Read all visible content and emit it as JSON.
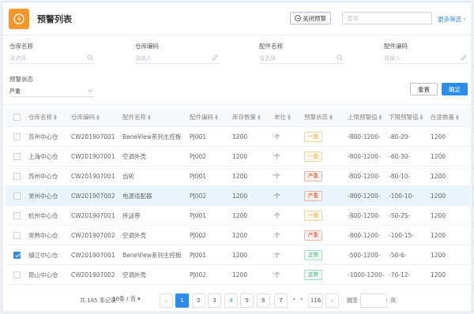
{
  "header": {
    "title": "预警列表",
    "close_warning_label": "关闭预警",
    "search_placeholder": "搜索",
    "more_filters_label": "更多筛选"
  },
  "filters": {
    "warehouse_name": {
      "label": "仓库名称",
      "placeholder": "请选择"
    },
    "warehouse_code": {
      "label": "仓库编码",
      "placeholder": "请输入"
    },
    "part_name": {
      "label": "配件名称",
      "placeholder": "请选择"
    },
    "part_code": {
      "label": "配件编码",
      "placeholder": "请输入"
    },
    "warning_status": {
      "label": "预警状态",
      "value": "严重"
    },
    "reset_label": "重置",
    "confirm_label": "确定"
  },
  "table": {
    "columns": [
      "仓库名称",
      "仓库编码",
      "配件名称",
      "配件编码",
      "库存数量",
      "单位",
      "预警状态",
      "上限预警值",
      "下限预警值",
      "在途数量"
    ],
    "rows": [
      {
        "wh": "苏州中心仓",
        "code": "CW201907001",
        "part": "BeneView系列主控板",
        "pcode": "PJ001",
        "qty": "1200",
        "unit": "个",
        "status": "一般",
        "upper": "-800-1200-",
        "lower": "-80-20-",
        "transit": "1200",
        "checked": false,
        "highlight": false
      },
      {
        "wh": "上海中心仓",
        "code": "CW201907001",
        "part": "空调外壳",
        "pcode": "PJ002",
        "qty": "1200",
        "unit": "个",
        "status": "一般",
        "upper": "-800-1200-",
        "lower": "-60-30-",
        "transit": "1200",
        "checked": false,
        "highlight": false
      },
      {
        "wh": "苏州中心仓",
        "code": "CW201907001",
        "part": "齿轮",
        "pcode": "PJ001",
        "qty": "1200",
        "unit": "个",
        "status": "严重",
        "upper": "-800-1200-",
        "lower": "-80-10-",
        "transit": "1200",
        "checked": false,
        "highlight": false
      },
      {
        "wh": "常州中心仓",
        "code": "CW201907002",
        "part": "电源适配器",
        "pcode": "PJ002",
        "qty": "1200",
        "unit": "个",
        "status": "严重",
        "upper": "-800-1200-",
        "lower": "-100-10-",
        "transit": "1200",
        "checked": false,
        "highlight": true
      },
      {
        "wh": "杭州中心仓",
        "code": "CW201907001",
        "part": "传送带",
        "pcode": "PJ001",
        "qty": "1200",
        "unit": "个",
        "status": "一般",
        "upper": "-800-1200-",
        "lower": "-50-25-",
        "transit": "1200",
        "checked": false,
        "highlight": false
      },
      {
        "wh": "常熟中心仓",
        "code": "CW201907002",
        "part": "空调外壳",
        "pcode": "PJ002",
        "qty": "1200",
        "unit": "个",
        "status": "严重",
        "upper": "-800-1200-",
        "lower": "-100-15-",
        "transit": "1200",
        "checked": false,
        "highlight": false
      },
      {
        "wh": "镇江中心仓",
        "code": "CW201907001",
        "part": "BeneView系列主控板",
        "pcode": "PJ001",
        "qty": "1200",
        "unit": "个",
        "status": "正常",
        "upper": "-500-1200-",
        "lower": "-50-6-",
        "transit": "1200",
        "checked": true,
        "highlight": false
      },
      {
        "wh": "昆山中心仓",
        "code": "CW201907002",
        "part": "空调外壳",
        "pcode": "PJ002",
        "qty": "1200",
        "unit": "个",
        "status": "正常",
        "upper": "-1000-1200-",
        "lower": "-70-12-",
        "transit": "1200",
        "checked": false,
        "highlight": false
      }
    ]
  },
  "status_colors": {
    "一般": {
      "text": "#f5a623",
      "border": "#f8d49a",
      "bg": "#fff8ec"
    },
    "严重": {
      "text": "#ed4014",
      "border": "#f7b2a0",
      "bg": "#fff1ee"
    },
    "正常": {
      "text": "#19be6b",
      "border": "#9ee3bf",
      "bg": "#eefaf3"
    }
  },
  "pagination": {
    "total_prefix": "共",
    "total": "185",
    "total_suffix": "条记录",
    "page_size": "10条 / 页",
    "pages": [
      "1",
      "2",
      "3",
      "4",
      "5",
      "6",
      "7"
    ],
    "dots": "• • •",
    "last_page": "116",
    "current_page": "1",
    "jump_label": "跳至",
    "page_suffix": "页"
  }
}
